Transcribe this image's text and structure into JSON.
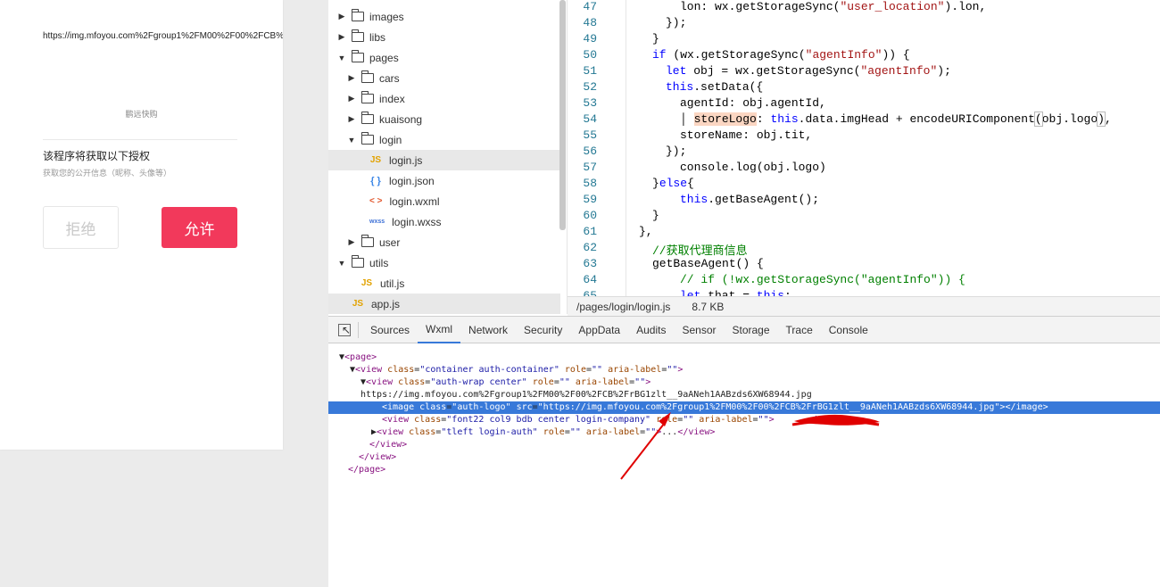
{
  "simulator": {
    "image_url": "https://img.mfoyou.com%2Fgroup1%2FM00%2F00%2FCB%2FrBG1zlt__9aANeh1AABzds6XW68944.jpg",
    "company_name": "鹏远快购",
    "auth_title": "该程序将获取以下授权",
    "auth_subtitle": "获取您的公开信息（昵称、头像等）",
    "reject_label": "拒绝",
    "allow_label": "允许",
    "allow_color": "#f2395b"
  },
  "file_tree": {
    "items": [
      {
        "label": "images",
        "type": "folder",
        "expanded": false
      },
      {
        "label": "libs",
        "type": "folder",
        "expanded": false
      },
      {
        "label": "pages",
        "type": "folder",
        "expanded": true
      },
      {
        "label": "cars",
        "type": "folder",
        "expanded": false
      },
      {
        "label": "index",
        "type": "folder",
        "expanded": false
      },
      {
        "label": "kuaisong",
        "type": "folder",
        "expanded": false
      },
      {
        "label": "login",
        "type": "folder",
        "expanded": true
      },
      {
        "label": "login.js",
        "type": "js",
        "badge": "JS",
        "selected": true
      },
      {
        "label": "login.json",
        "type": "json",
        "badge": "{ }"
      },
      {
        "label": "login.wxml",
        "type": "wxml",
        "badge": "< >"
      },
      {
        "label": "login.wxss",
        "type": "wxss",
        "badge": "wxss"
      },
      {
        "label": "user",
        "type": "folder",
        "expanded": false
      },
      {
        "label": "utils",
        "type": "folder",
        "expanded": true
      },
      {
        "label": "util.js",
        "type": "js",
        "badge": "JS"
      },
      {
        "label": "app.js",
        "type": "js",
        "badge": "JS",
        "hovered": true
      }
    ]
  },
  "editor": {
    "line_numbers": [
      "47",
      "48",
      "49",
      "50",
      "51",
      "52",
      "53",
      "54",
      "55",
      "56",
      "57",
      "58",
      "59",
      "60",
      "61",
      "62",
      "63",
      "64",
      "65"
    ],
    "file_path": "/pages/login/login.js",
    "file_size": "8.7 KB"
  },
  "devtools": {
    "tabs": [
      "Sources",
      "Wxml",
      "Network",
      "Security",
      "AppData",
      "Audits",
      "Sensor",
      "Storage",
      "Trace",
      "Console"
    ],
    "active_tab": "Wxml",
    "selection_color": "#3879d9"
  },
  "annotation": {
    "arrow_color": "#e00000"
  }
}
